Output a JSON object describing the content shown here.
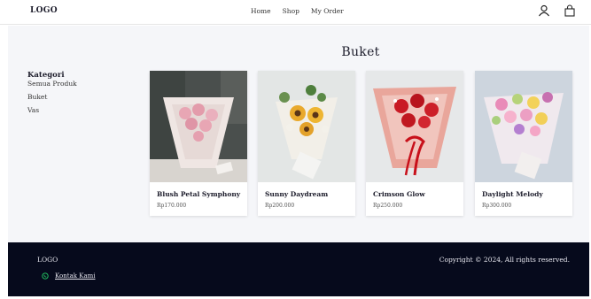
{
  "nav": {
    "logo": "LOGO",
    "links": [
      "Home",
      "Shop",
      "My Order"
    ],
    "icons": [
      "user-icon",
      "shopping-bag-icon"
    ]
  },
  "page": {
    "title": "Buket"
  },
  "sidebar": {
    "heading": "Kategori",
    "items": [
      "Semua Produk",
      "Buket",
      "Vas"
    ]
  },
  "products": [
    {
      "name": "Blush Petal Symphony",
      "price": "Rp170.000",
      "flower_color": "#e8a6b4"
    },
    {
      "name": "Sunny Daydream",
      "price": "Rp200.000",
      "flower_color": "#e9a92c"
    },
    {
      "name": "Crimson Glow",
      "price": "Rp250.000",
      "flower_color": "#c91a24"
    },
    {
      "name": "Daylight Melody",
      "price": "Rp300.000",
      "flower_color": "#e98bb8"
    }
  ],
  "footer": {
    "logo": "LOGO",
    "contact_label": "Kontak Kami",
    "contact_icon": "whatsapp-icon",
    "copyright": "Copyright © 2024, All rights reserved."
  },
  "colors": {
    "footer_bg": "#060a1c",
    "main_bg": "#f5f6f9",
    "whatsapp_green": "#25d366"
  }
}
